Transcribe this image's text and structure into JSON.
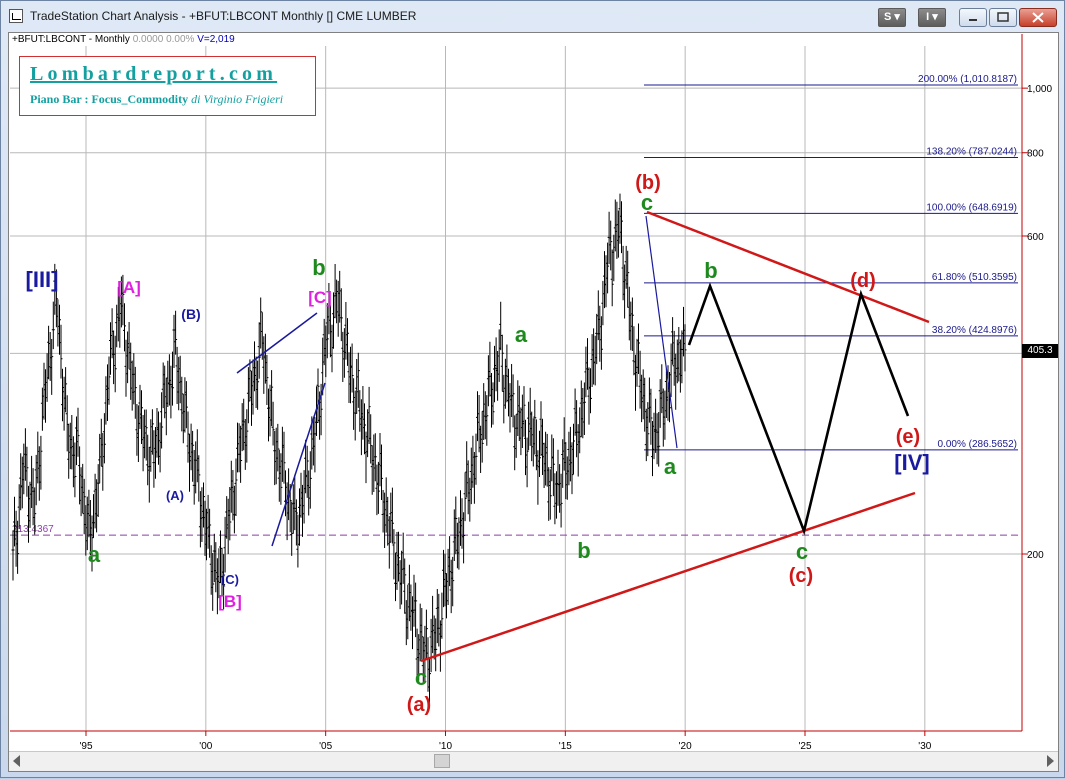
{
  "window": {
    "title": "TradeStation Chart Analysis - +BFUT:LBCONT Monthly [] CME LUMBER",
    "buttons": {
      "s": "S ▾",
      "i": "I ▾"
    },
    "icons": [
      "chart-icon",
      "minimize-icon",
      "restore-icon",
      "maximize-icon",
      "close-icon"
    ]
  },
  "symbol_bar": {
    "symbol": "+BFUT:LBCONT - Monthly",
    "change": "0.0000",
    "pct": "0.00%",
    "volume": "V=2,019"
  },
  "logo": {
    "title": "Lombardreport.com",
    "subtitle": "Piano Bar : Focus_Commodity",
    "author": "di Virginio Frigieri"
  },
  "chart_data": {
    "type": "line",
    "scale": "log",
    "xticks": [
      "'95",
      "'00",
      "'05",
      "'10",
      "'15",
      "'20",
      "'25",
      "'30"
    ],
    "yticks": [
      {
        "value": 200,
        "label": "200"
      },
      {
        "value": 400,
        "label": "400"
      },
      {
        "value": 600,
        "label": "600"
      },
      {
        "value": 800,
        "label": "800"
      },
      {
        "value": 1000,
        "label": "1,000"
      }
    ],
    "last_price": "405.3",
    "support_label": "213.4367",
    "fib_levels": [
      {
        "label": "200.00% (1,010.8187)",
        "value": 1010.8187
      },
      {
        "label": "138.20% (787.0244)",
        "value": 787.0244
      },
      {
        "label": "100.00% (648.6919)",
        "value": 648.6919
      },
      {
        "label": "61.80% (510.3595)",
        "value": 510.3595
      },
      {
        "label": "38.20% (424.8976)",
        "value": 424.8976
      },
      {
        "label": "0.00% (286.5652)",
        "value": 286.5652
      }
    ],
    "wave_labels": [
      {
        "text": "[III]",
        "color": "#1a1aa0"
      },
      {
        "text": "[A]",
        "color": "#e020e0"
      },
      {
        "text": "(B)",
        "color": "#1a1aa0"
      },
      {
        "text": "(A)",
        "color": "#1a1aa0"
      },
      {
        "text": "a",
        "color": "#1e8a1e"
      },
      {
        "text": "(C)",
        "color": "#1a1aa0"
      },
      {
        "text": "[B]",
        "color": "#e020e0"
      },
      {
        "text": "b",
        "color": "#1e8a1e"
      },
      {
        "text": "[C]",
        "color": "#e020e0"
      },
      {
        "text": "c",
        "color": "#1e8a1e"
      },
      {
        "text": "(a)",
        "color": "#d01818"
      },
      {
        "text": "a",
        "color": "#1e8a1e"
      },
      {
        "text": "b",
        "color": "#1e8a1e"
      },
      {
        "text": "(b)",
        "color": "#d01818"
      },
      {
        "text": "c",
        "color": "#1e8a1e"
      },
      {
        "text": "a",
        "color": "#1e8a1e"
      },
      {
        "text": "b",
        "color": "#1e8a1e"
      },
      {
        "text": "c",
        "color": "#1e8a1e"
      },
      {
        "text": "(c)",
        "color": "#d01818"
      },
      {
        "text": "(d)",
        "color": "#d01818"
      },
      {
        "text": "(e)",
        "color": "#d01818"
      },
      {
        "text": "[IV]",
        "color": "#1a1aa0"
      }
    ],
    "series": [
      {
        "values": [
          195,
          270,
          235,
          350,
          480,
          300,
          280,
          210,
          260,
          390,
          470,
          360,
          300,
          280,
          340,
          400,
          310,
          260,
          210,
          180,
          230,
          290,
          350,
          420,
          300,
          260,
          220,
          250,
          310,
          430,
          480,
          380,
          330,
          290,
          250,
          210,
          180,
          160,
          140,
          150,
          180,
          210,
          250,
          300,
          350,
          400,
          330,
          310,
          300,
          280,
          250,
          270,
          300,
          360,
          420,
          560,
          620,
          440,
          350,
          300,
          330,
          390,
          405
        ]
      }
    ]
  }
}
